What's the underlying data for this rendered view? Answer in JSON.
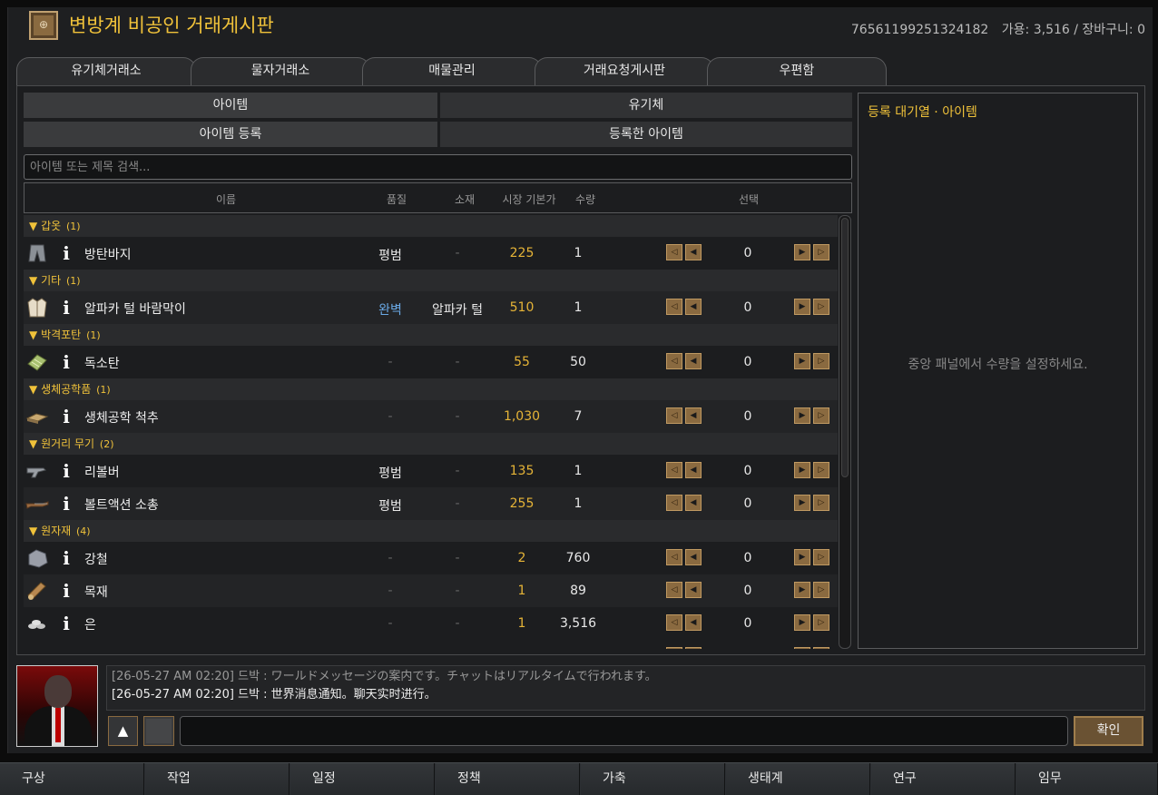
{
  "header": {
    "title": "변방계 비공인 거래게시판",
    "user_id": "76561199251324182",
    "available": "가용: 3,516 / 장바구니: 0"
  },
  "tabs": [
    {
      "label": "유기체거래소"
    },
    {
      "label": "물자거래소"
    },
    {
      "label": "매물관리"
    },
    {
      "label": "거래요청게시판"
    },
    {
      "label": "우편함"
    }
  ],
  "subtabs": {
    "item": "아이템",
    "organism": "유기체",
    "register": "아이템 등록",
    "registered": "등록한 아이템"
  },
  "search": {
    "placeholder": "아이템 또는 제목 검색...",
    "value": ""
  },
  "columns": {
    "name": "이름",
    "quality": "품질",
    "material": "소재",
    "price": "시장 기본가",
    "qty": "수량",
    "select": "선택"
  },
  "groups": [
    {
      "name": "갑옷",
      "count": "(1)",
      "items": [
        {
          "icon": "pants-icon",
          "name": "방탄바지",
          "quality": "평범",
          "material": "-",
          "price": "225",
          "qty": "1",
          "selected": "0"
        }
      ]
    },
    {
      "name": "기타",
      "count": "(1)",
      "items": [
        {
          "icon": "jacket-icon",
          "name": "알파카 털 바람막이",
          "quality": "완벽",
          "material": "알파카 털",
          "price": "510",
          "qty": "1",
          "selected": "0"
        }
      ]
    },
    {
      "name": "박격포탄",
      "count": "(1)",
      "items": [
        {
          "icon": "shell-icon",
          "name": "독소탄",
          "quality": "-",
          "material": "-",
          "price": "55",
          "qty": "50",
          "selected": "0"
        }
      ]
    },
    {
      "name": "생체공학품",
      "count": "(1)",
      "items": [
        {
          "icon": "bionic-icon",
          "name": "생체공학 척추",
          "quality": "-",
          "material": "-",
          "price": "1,030",
          "qty": "7",
          "selected": "0"
        }
      ]
    },
    {
      "name": "원거리 무기",
      "count": "(2)",
      "items": [
        {
          "icon": "revolver-icon",
          "name": "리볼버",
          "quality": "평범",
          "material": "-",
          "price": "135",
          "qty": "1",
          "selected": "0"
        },
        {
          "icon": "rifle-icon",
          "name": "볼트액션 소총",
          "quality": "평범",
          "material": "-",
          "price": "255",
          "qty": "1",
          "selected": "0"
        }
      ]
    },
    {
      "name": "원자재",
      "count": "(4)",
      "items": [
        {
          "icon": "steel-icon",
          "name": "강철",
          "quality": "-",
          "material": "-",
          "price": "2",
          "qty": "760",
          "selected": "0"
        },
        {
          "icon": "wood-icon",
          "name": "목재",
          "quality": "-",
          "material": "-",
          "price": "1",
          "qty": "89",
          "selected": "0"
        },
        {
          "icon": "silver-icon",
          "name": "은",
          "quality": "-",
          "material": "-",
          "price": "1",
          "qty": "3,516",
          "selected": "0"
        }
      ]
    }
  ],
  "queue": {
    "title": "등록 대기열 · 아이템",
    "empty_message": "중앙 패널에서 수량을 설정하세요."
  },
  "chat": {
    "messages": [
      "[26-05-27 AM 02:20] 드박 : ワールドメッセージの案内です。チャットはリアルタイムで行われます。",
      "[26-05-27 AM 02:20] 드박 : 世界消息通知。聊天实时进行。"
    ],
    "input_value": "",
    "up_label": "▲",
    "confirm_label": "확인"
  },
  "bottom_bar": [
    "구상",
    "작업",
    "일정",
    "정책",
    "가축",
    "생태계",
    "연구",
    "임무"
  ],
  "colors": {
    "accent": "#f0c23a",
    "perfect_quality": "#6aa9e6",
    "button_brown": "#8a6a40"
  }
}
